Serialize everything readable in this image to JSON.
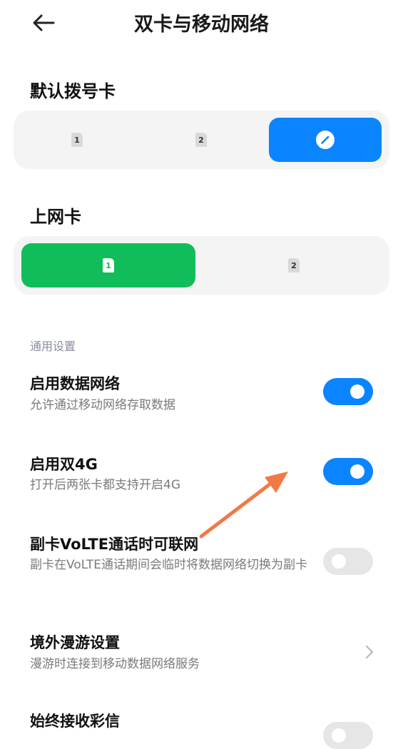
{
  "header": {
    "title": "双卡与移动网络"
  },
  "dial_card": {
    "label": "默认拨号卡",
    "options": [
      "1",
      "2",
      "edit"
    ],
    "selected": "edit",
    "accent": "#0b84ff"
  },
  "data_card": {
    "label": "上网卡",
    "options": [
      "1",
      "2"
    ],
    "selected": "1",
    "accent": "#10bd5a"
  },
  "general": {
    "label": "通用设置",
    "items": [
      {
        "title": "启用数据网络",
        "subtitle": "允许通过移动网络存取数据",
        "toggle": true
      },
      {
        "title": "启用双4G",
        "subtitle": "打开后两张卡都支持开启4G",
        "toggle": true
      },
      {
        "title": "副卡VoLTE通话时可联网",
        "subtitle": "副卡在VoLTE通话期间会临时将数据网络切换为副卡",
        "toggle": false
      },
      {
        "title": "境外漫游设置",
        "subtitle": "漫游时连接到移动数据网络服务",
        "chevron": true
      },
      {
        "title": "始终接收彩信"
      }
    ]
  },
  "annotation": {
    "color": "#f07a45"
  },
  "icons": [
    "back-arrow-icon",
    "sim-card-icon",
    "edit-pencil-icon",
    "chevron-right-icon",
    "annotation-arrow-icon"
  ]
}
